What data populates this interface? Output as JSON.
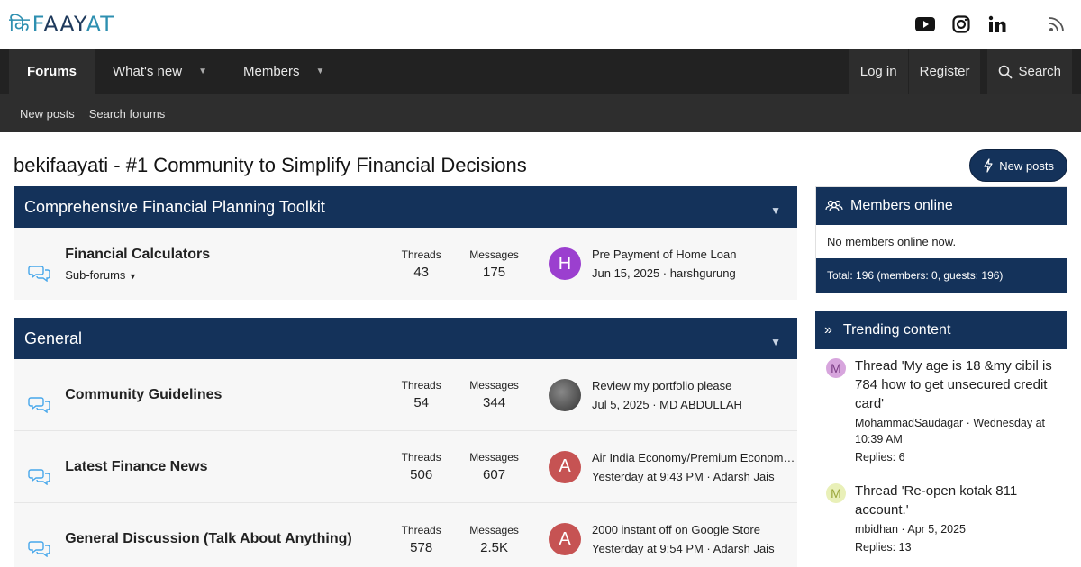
{
  "brand": {
    "logo_ki": "कि",
    "logo_rest_a": "F",
    "logo_rest_b": "AAY",
    "logo_rest_c": "AT"
  },
  "nav": {
    "tabs": [
      {
        "label": "Forums"
      },
      {
        "label": "What's new"
      },
      {
        "label": "Members"
      }
    ],
    "login": "Log in",
    "register": "Register",
    "search": "Search"
  },
  "subnav": {
    "new_posts": "New posts",
    "search_forums": "Search forums"
  },
  "page": {
    "title": "bekifaayati - #1 Community to Simplify Financial Decisions",
    "new_posts_button": "New posts"
  },
  "categories": [
    {
      "title": "Comprehensive Financial Planning Toolkit",
      "nodes": [
        {
          "title": "Financial Calculators",
          "sub": "Sub-forums",
          "threads_label": "Threads",
          "threads": "43",
          "messages_label": "Messages",
          "messages": "175",
          "avatar_letter": "H",
          "avatar_color": "#9b3fcf",
          "latest_title": "Pre Payment of Home Loan",
          "latest_meta": "Jun 15, 2025 · harshgurung"
        }
      ]
    },
    {
      "title": "General",
      "nodes": [
        {
          "title": "Community Guidelines",
          "sub": "",
          "threads_label": "Threads",
          "threads": "54",
          "messages_label": "Messages",
          "messages": "344",
          "avatar_letter": "",
          "avatar_color": "#555555",
          "latest_title": "Review my portfolio please",
          "latest_meta": "Jul 5, 2025 · MD ABDULLAH"
        },
        {
          "title": "Latest Finance News",
          "sub": "",
          "threads_label": "Threads",
          "threads": "506",
          "messages_label": "Messages",
          "messages": "607",
          "avatar_letter": "A",
          "avatar_color": "#c65353",
          "latest_title": "Air India Economy/Premium Economy ...",
          "latest_meta": "Yesterday at 9:43 PM · Adarsh Jais"
        },
        {
          "title": "General Discussion (Talk About Anything)",
          "sub": "",
          "threads_label": "Threads",
          "threads": "578",
          "messages_label": "Messages",
          "messages": "2.5K",
          "avatar_letter": "A",
          "avatar_color": "#c65353",
          "latest_title": "2000 instant off on Google Store",
          "latest_meta": "Yesterday at 9:54 PM · Adarsh Jais"
        }
      ]
    }
  ],
  "sidebar": {
    "members_online": {
      "title": "Members online",
      "body": "No members online now.",
      "footer": "Total: 196 (members: 0, guests: 196)"
    },
    "trending": {
      "title": "Trending content",
      "items": [
        {
          "avatar_letter": "M",
          "avatar_bg": "#d7a5dd",
          "avatar_fg": "#7a3b84",
          "title": "Thread 'My age is 18 &my cibil is 784 how to get unsecured credit card'",
          "meta": "MohammadSaudagar · Wednesday at 10:39 AM",
          "replies": "Replies: 6"
        },
        {
          "avatar_letter": "M",
          "avatar_bg": "#e9f0b8",
          "avatar_fg": "#9aa63a",
          "title": "Thread 'Re-open kotak 811 account.'",
          "meta": "mbidhan · Apr 5, 2025",
          "replies": "Replies: 13"
        }
      ]
    }
  },
  "colors": {
    "primary": "#14325a",
    "nav_bg": "#222222",
    "subnav_bg": "#2e2e2e"
  }
}
